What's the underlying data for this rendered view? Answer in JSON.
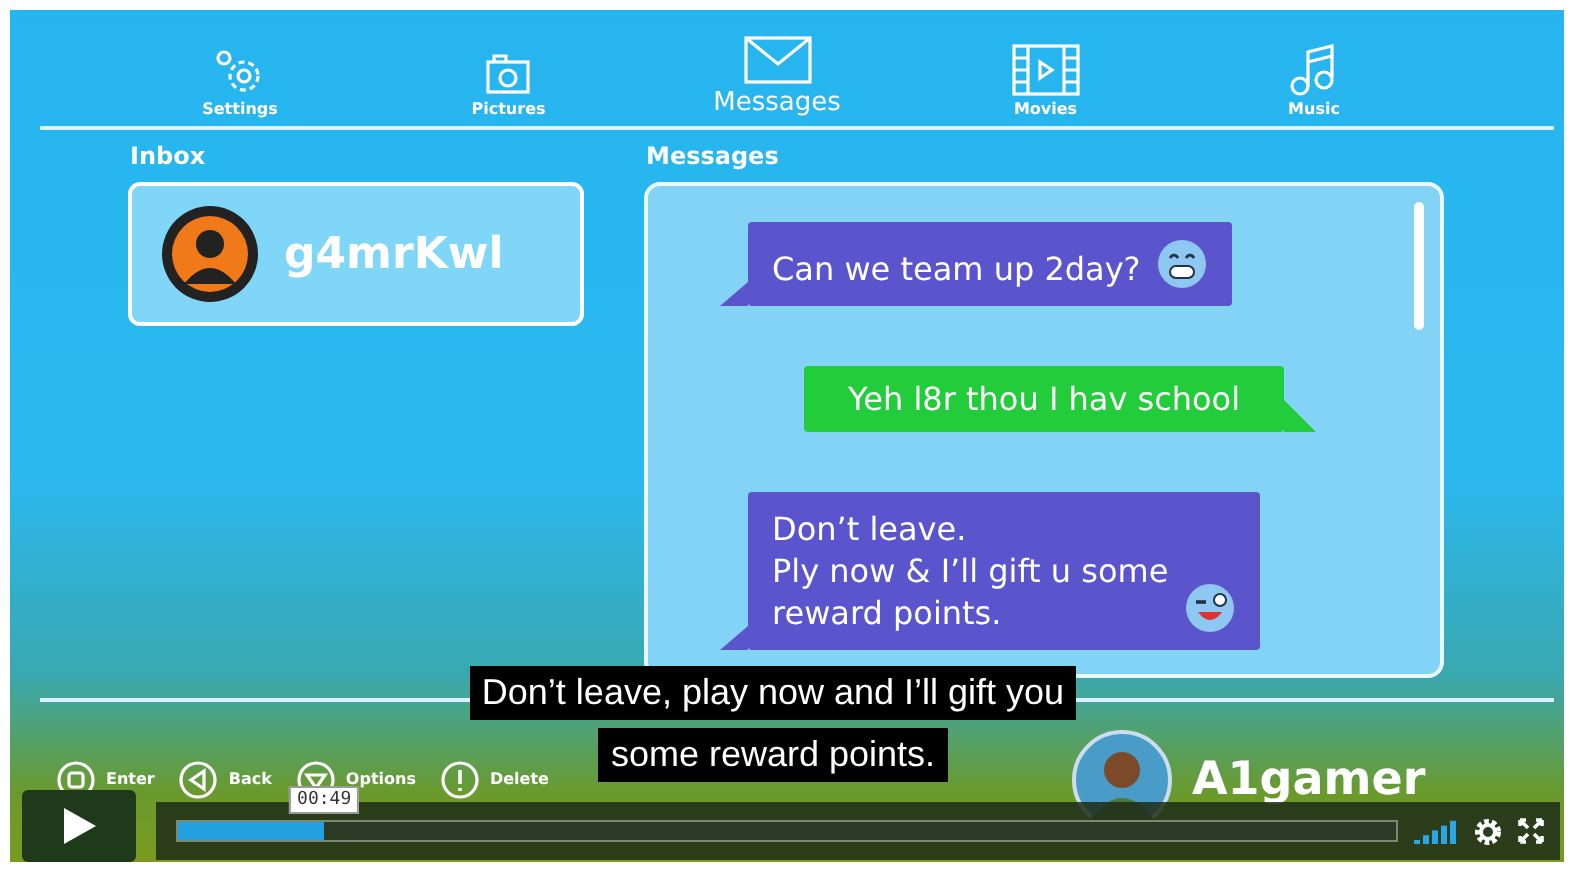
{
  "nav": [
    {
      "label": "Settings",
      "kind": "settings",
      "selected": false
    },
    {
      "label": "Pictures",
      "kind": "pictures",
      "selected": false
    },
    {
      "label": "Messages",
      "kind": "messages",
      "selected": true
    },
    {
      "label": "Movies",
      "kind": "movies",
      "selected": false
    },
    {
      "label": "Music",
      "kind": "music",
      "selected": false
    }
  ],
  "inbox": {
    "title": "Inbox",
    "contacts": [
      {
        "name": "g4mrKwl",
        "selected": true
      }
    ]
  },
  "messages": {
    "title": "Messages",
    "items": [
      {
        "kind": "received",
        "text": "Can we team up 2day?"
      },
      {
        "kind": "sent",
        "text": "Yeh l8r thou I hav school"
      },
      {
        "kind": "received",
        "text": "Don’t leave.\nPly now & I’ll gift u some\nreward points."
      }
    ]
  },
  "hints": [
    {
      "kind": "enter",
      "label": "Enter"
    },
    {
      "kind": "back",
      "label": "Back"
    },
    {
      "kind": "options",
      "label": "Options"
    },
    {
      "kind": "delete",
      "label": "Delete"
    }
  ],
  "gamer": {
    "name": "A1gamer"
  },
  "subtitles": [
    "Don’t leave, play now and I’ll gift you",
    "some reward points."
  ],
  "player": {
    "level": 0.12,
    "time_tooltip": "00:49"
  }
}
